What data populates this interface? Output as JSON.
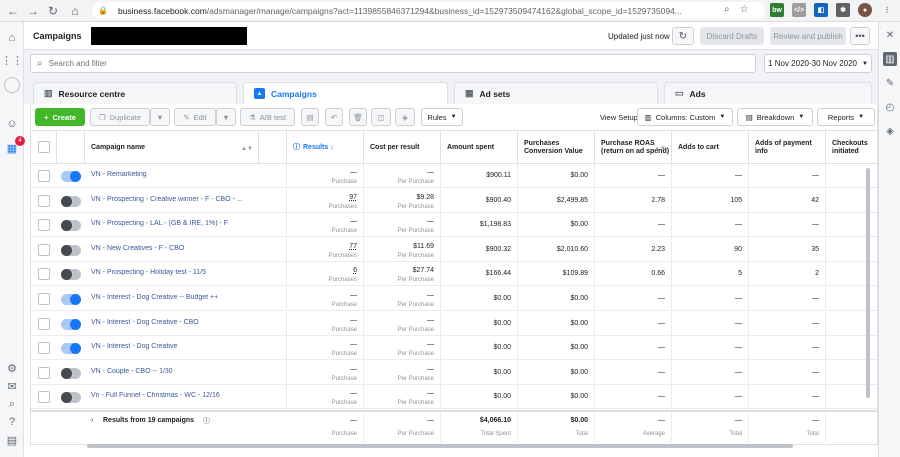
{
  "browser": {
    "url_host": "business.facebook.com",
    "url_path": "/adsmanager/manage/campaigns?act=113985584637129​4&business_id=152973509474162&global_scope_id=1529735094..."
  },
  "header": {
    "title": "Campaigns",
    "updated": "Updated just now",
    "discard": "Discard Drafts",
    "review": "Review and publish"
  },
  "left_nav": {
    "badge": "4"
  },
  "search": {
    "placeholder": "Search and filter",
    "date_range": "1 Nov 2020-30 Nov 2020"
  },
  "tabs": [
    {
      "label": "Resource centre"
    },
    {
      "label": "Campaigns"
    },
    {
      "label": "Ad sets"
    },
    {
      "label": "Ads"
    }
  ],
  "toolbar": {
    "create": "Create",
    "duplicate": "Duplicate",
    "edit": "Edit",
    "ab_test": "A/B test",
    "rules": "Rules",
    "view_setup": "View Setup",
    "columns": "Columns: Custom",
    "breakdown": "Breakdown",
    "reports": "Reports"
  },
  "columns": {
    "name": "Campaign name",
    "results": "Results",
    "cost": "Cost per result",
    "spent": "Amount spent",
    "conv": "Purchases Conversion Value",
    "roas": "Purchase ROAS (return on ad spend)",
    "cart": "Adds to cart",
    "payment": "Adds of payment info",
    "checkout": "Checkouts initiated"
  },
  "rows": [
    {
      "name": "VN - Remarketing",
      "on": true,
      "results": "—",
      "results_sub": "Purchase",
      "cost": "—",
      "cost_sub": "Per Purchase",
      "spent": "$900.11",
      "conv": "$0.00",
      "roas": "—",
      "cart": "—",
      "payment": "—"
    },
    {
      "name": "VN - Prospecting - Creative winner - F - CBO - ...",
      "on": false,
      "results": "97",
      "results_sub": "Purchases",
      "cost": "$9.28",
      "cost_sub": "Per Purchase",
      "spent": "$900.40",
      "conv": "$2,499.85",
      "roas": "2.78",
      "cart": "105",
      "payment": "42"
    },
    {
      "name": "VN - Prospecting - LAL - (GB & IRE, 1%) - F",
      "on": false,
      "results": "—",
      "results_sub": "Purchase",
      "cost": "—",
      "cost_sub": "Per Purchase",
      "spent": "$1,198.83",
      "conv": "$0.00",
      "roas": "—",
      "cart": "—",
      "payment": "—"
    },
    {
      "name": "VN - New Creatives - F - CBO",
      "on": false,
      "results": "77",
      "results_sub": "Purchases",
      "cost": "$11.69",
      "cost_sub": "Per Purchase",
      "spent": "$900.32",
      "conv": "$2,010.60",
      "roas": "2.23",
      "cart": "90",
      "payment": "35"
    },
    {
      "name": "VN - Prospecting - Holiday test - 11/5",
      "on": false,
      "results": "6",
      "results_sub": "Purchases",
      "cost": "$27.74",
      "cost_sub": "Per Purchase",
      "spent": "$166.44",
      "conv": "$109.89",
      "roas": "0.66",
      "cart": "5",
      "payment": "2"
    },
    {
      "name": "VN - Interest - Dog Creative -- Budget ++",
      "on": true,
      "results": "—",
      "results_sub": "Purchase",
      "cost": "—",
      "cost_sub": "Per Purchase",
      "spent": "$0.00",
      "conv": "$0.00",
      "roas": "—",
      "cart": "—",
      "payment": "—"
    },
    {
      "name": "VN - Interest - Dog Creative - CBO",
      "on": true,
      "results": "—",
      "results_sub": "Purchase",
      "cost": "—",
      "cost_sub": "Per Purchase",
      "spent": "$0.00",
      "conv": "$0.00",
      "roas": "—",
      "cart": "—",
      "payment": "—"
    },
    {
      "name": "VN - Interest - Dog Creative",
      "on": true,
      "results": "—",
      "results_sub": "Purchase",
      "cost": "—",
      "cost_sub": "Per Purchase",
      "spent": "$0.00",
      "conv": "$0.00",
      "roas": "—",
      "cart": "—",
      "payment": "—"
    },
    {
      "name": "VN - Couple - CBO -- 1/30",
      "on": false,
      "results": "—",
      "results_sub": "Purchase",
      "cost": "—",
      "cost_sub": "Per Purchase",
      "spent": "$0.00",
      "conv": "$0.00",
      "roas": "—",
      "cart": "—",
      "payment": "—"
    },
    {
      "name": "Vn - Full Funnel - Christmas - WC - 12/16",
      "on": false,
      "results": "—",
      "results_sub": "Purchase",
      "cost": "—",
      "cost_sub": "Per Purchase",
      "spent": "$0.00",
      "conv": "$0.00",
      "roas": "—",
      "cart": "—",
      "payment": "—"
    }
  ],
  "totals": {
    "label": "Results from 19 campaigns",
    "results": "—",
    "results_sub": "Purchase",
    "cost": "—",
    "cost_sub": "Per Purchase",
    "spent": "$4,066.10",
    "spent_sub": "Total Spent",
    "conv": "$0.00",
    "conv_sub": "Total",
    "roas": "—",
    "roas_sub": "Average",
    "cart": "—",
    "cart_sub": "Total",
    "payment": "—",
    "payment_sub": "Total"
  }
}
